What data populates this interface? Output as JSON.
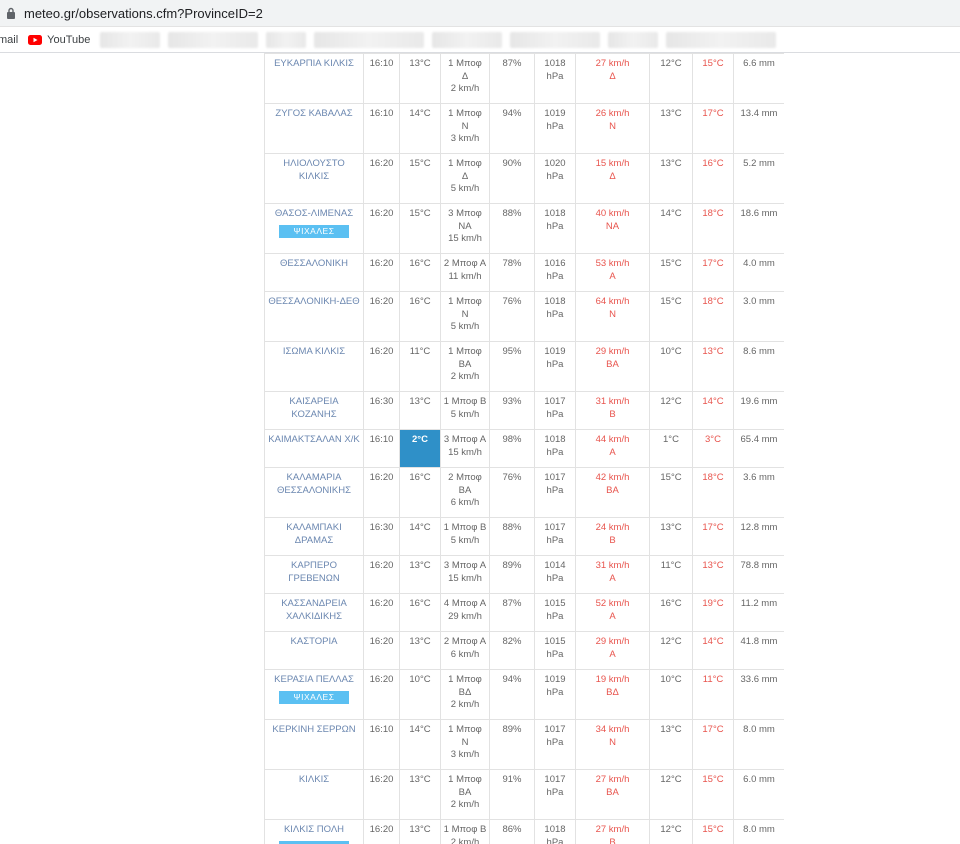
{
  "browser": {
    "url": "meteo.gr/observations.cfm?ProvinceID=2",
    "bookmarks": [
      {
        "label": "mail"
      },
      {
        "label": "YouTube"
      }
    ]
  },
  "colors": {
    "station_name": "#6b87b0",
    "wind_and_max": "#e8544d",
    "badge": "#5bc0f2",
    "highlight": "#2f90c8"
  },
  "rows": [
    {
      "station": "ΕΥΚΑΡΠΙΑ ΚΙΛΚΙΣ",
      "badge": "",
      "time": "16:10",
      "temp": "13°C",
      "hl": false,
      "wind_bf": "1 Μποφ",
      "wind_dir": "Δ",
      "wind_kmh": "2 km/h",
      "humidity": "87%",
      "pressure": "1018",
      "pressure_unit": "hPa",
      "gust": "27 km/h",
      "gust_dir": "Δ",
      "min": "12°C",
      "max": "15°C",
      "rain": "6.6 mm"
    },
    {
      "station": "ΖΥΓΟΣ ΚΑΒΑΛΑΣ",
      "badge": "",
      "time": "16:10",
      "temp": "14°C",
      "hl": false,
      "wind_bf": "1 Μποφ",
      "wind_dir": "Ν",
      "wind_kmh": "3 km/h",
      "humidity": "94%",
      "pressure": "1019",
      "pressure_unit": "hPa",
      "gust": "26 km/h",
      "gust_dir": "Ν",
      "min": "13°C",
      "max": "17°C",
      "rain": "13.4 mm"
    },
    {
      "station": "ΗΛΙΟΛΟΥΣΤΟ ΚΙΛΚΙΣ",
      "badge": "",
      "time": "16:20",
      "temp": "15°C",
      "hl": false,
      "wind_bf": "1 Μποφ",
      "wind_dir": "Δ",
      "wind_kmh": "5 km/h",
      "humidity": "90%",
      "pressure": "1020",
      "pressure_unit": "hPa",
      "gust": "15 km/h",
      "gust_dir": "Δ",
      "min": "13°C",
      "max": "16°C",
      "rain": "5.2 mm"
    },
    {
      "station": "ΘΑΣΟΣ-ΛΙΜΕΝΑΣ",
      "badge": "ΨΙΧΑΛΕΣ",
      "time": "16:20",
      "temp": "15°C",
      "hl": false,
      "wind_bf": "3 Μποφ",
      "wind_dir": "ΝΑ",
      "wind_kmh": "15 km/h",
      "humidity": "88%",
      "pressure": "1018",
      "pressure_unit": "hPa",
      "gust": "40 km/h",
      "gust_dir": "ΝΑ",
      "min": "14°C",
      "max": "18°C",
      "rain": "18.6 mm"
    },
    {
      "station": "ΘΕΣΣΑΛΟΝΙΚΗ",
      "badge": "",
      "time": "16:20",
      "temp": "16°C",
      "hl": false,
      "wind_bf": "2 Μποφ Α",
      "wind_dir": "",
      "wind_kmh": "11 km/h",
      "humidity": "78%",
      "pressure": "1016",
      "pressure_unit": "hPa",
      "gust": "53 km/h",
      "gust_dir": "Α",
      "min": "15°C",
      "max": "17°C",
      "rain": "4.0 mm"
    },
    {
      "station": "ΘΕΣΣΑΛΟΝΙΚΗ-ΔΕΘ",
      "badge": "",
      "time": "16:20",
      "temp": "16°C",
      "hl": false,
      "wind_bf": "1 Μποφ",
      "wind_dir": "Ν",
      "wind_kmh": "5 km/h",
      "humidity": "76%",
      "pressure": "1018",
      "pressure_unit": "hPa",
      "gust": "64 km/h",
      "gust_dir": "Ν",
      "min": "15°C",
      "max": "18°C",
      "rain": "3.0 mm"
    },
    {
      "station": "ΙΣΩΜΑ ΚΙΛΚΙΣ",
      "badge": "",
      "time": "16:20",
      "temp": "11°C",
      "hl": false,
      "wind_bf": "1 Μποφ",
      "wind_dir": "ΒΑ",
      "wind_kmh": "2 km/h",
      "humidity": "95%",
      "pressure": "1019",
      "pressure_unit": "hPa",
      "gust": "29 km/h",
      "gust_dir": "ΒΑ",
      "min": "10°C",
      "max": "13°C",
      "rain": "8.6 mm"
    },
    {
      "station": "ΚΑΙΣΑΡΕΙΑ ΚΟΖΑΝΗΣ",
      "badge": "",
      "time": "16:30",
      "temp": "13°C",
      "hl": false,
      "wind_bf": "1 Μποφ Β",
      "wind_dir": "",
      "wind_kmh": "5 km/h",
      "humidity": "93%",
      "pressure": "1017",
      "pressure_unit": "hPa",
      "gust": "31 km/h",
      "gust_dir": "Β",
      "min": "12°C",
      "max": "14°C",
      "rain": "19.6 mm"
    },
    {
      "station": "ΚΑΙΜΑΚΤΣΑΛΑΝ Χ/Κ",
      "badge": "",
      "time": "16:10",
      "temp": "2°C",
      "hl": true,
      "wind_bf": "3 Μποφ Α",
      "wind_dir": "",
      "wind_kmh": "15 km/h",
      "humidity": "98%",
      "pressure": "1018",
      "pressure_unit": "hPa",
      "gust": "44 km/h",
      "gust_dir": "Α",
      "min": "1°C",
      "max": "3°C",
      "rain": "65.4 mm"
    },
    {
      "station": "ΚΑΛΑΜΑΡΙΑ ΘΕΣΣΑΛΟΝΙΚΗΣ",
      "badge": "",
      "time": "16:20",
      "temp": "16°C",
      "hl": false,
      "wind_bf": "2 Μποφ",
      "wind_dir": "ΒΑ",
      "wind_kmh": "6 km/h",
      "humidity": "76%",
      "pressure": "1017",
      "pressure_unit": "hPa",
      "gust": "42 km/h",
      "gust_dir": "ΒΑ",
      "min": "15°C",
      "max": "18°C",
      "rain": "3.6 mm"
    },
    {
      "station": "ΚΑΛΑΜΠΑΚΙ ΔΡΑΜΑΣ",
      "badge": "",
      "time": "16:30",
      "temp": "14°C",
      "hl": false,
      "wind_bf": "1 Μποφ Β",
      "wind_dir": "",
      "wind_kmh": "5 km/h",
      "humidity": "88%",
      "pressure": "1017",
      "pressure_unit": "hPa",
      "gust": "24 km/h",
      "gust_dir": "Β",
      "min": "13°C",
      "max": "17°C",
      "rain": "12.8 mm"
    },
    {
      "station": "ΚΑΡΠΕΡΟ ΓΡΕΒΕΝΩΝ",
      "badge": "",
      "time": "16:20",
      "temp": "13°C",
      "hl": false,
      "wind_bf": "3 Μποφ Α",
      "wind_dir": "",
      "wind_kmh": "15 km/h",
      "humidity": "89%",
      "pressure": "1014",
      "pressure_unit": "hPa",
      "gust": "31 km/h",
      "gust_dir": "Α",
      "min": "11°C",
      "max": "13°C",
      "rain": "78.8 mm"
    },
    {
      "station": "ΚΑΣΣΑΝΔΡΕΙΑ ΧΑΛΚΙΔΙΚΗΣ",
      "badge": "",
      "time": "16:20",
      "temp": "16°C",
      "hl": false,
      "wind_bf": "4 Μποφ Α",
      "wind_dir": "",
      "wind_kmh": "29 km/h",
      "humidity": "87%",
      "pressure": "1015",
      "pressure_unit": "hPa",
      "gust": "52 km/h",
      "gust_dir": "Α",
      "min": "16°C",
      "max": "19°C",
      "rain": "11.2 mm"
    },
    {
      "station": "ΚΑΣΤΟΡΙΑ",
      "badge": "",
      "time": "16:20",
      "temp": "13°C",
      "hl": false,
      "wind_bf": "2 Μποφ Α",
      "wind_dir": "",
      "wind_kmh": "6 km/h",
      "humidity": "82%",
      "pressure": "1015",
      "pressure_unit": "hPa",
      "gust": "29 km/h",
      "gust_dir": "Α",
      "min": "12°C",
      "max": "14°C",
      "rain": "41.8 mm"
    },
    {
      "station": "ΚΕΡΑΣΙΑ ΠΕΛΛΑΣ",
      "badge": "ΨΙΧΑΛΕΣ",
      "time": "16:20",
      "temp": "10°C",
      "hl": false,
      "wind_bf": "1 Μποφ",
      "wind_dir": "ΒΔ",
      "wind_kmh": "2 km/h",
      "humidity": "94%",
      "pressure": "1019",
      "pressure_unit": "hPa",
      "gust": "19 km/h",
      "gust_dir": "ΒΔ",
      "min": "10°C",
      "max": "11°C",
      "rain": "33.6 mm"
    },
    {
      "station": "ΚΕΡΚΙΝΗ ΣΕΡΡΩΝ",
      "badge": "",
      "time": "16:10",
      "temp": "14°C",
      "hl": false,
      "wind_bf": "1 Μποφ",
      "wind_dir": "Ν",
      "wind_kmh": "3 km/h",
      "humidity": "89%",
      "pressure": "1017",
      "pressure_unit": "hPa",
      "gust": "34 km/h",
      "gust_dir": "Ν",
      "min": "13°C",
      "max": "17°C",
      "rain": "8.0 mm"
    },
    {
      "station": "ΚΙΛΚΙΣ",
      "badge": "",
      "time": "16:20",
      "temp": "13°C",
      "hl": false,
      "wind_bf": "1 Μποφ",
      "wind_dir": "ΒΑ",
      "wind_kmh": "2 km/h",
      "humidity": "91%",
      "pressure": "1017",
      "pressure_unit": "hPa",
      "gust": "27 km/h",
      "gust_dir": "ΒΑ",
      "min": "12°C",
      "max": "15°C",
      "rain": "6.0 mm"
    },
    {
      "station": "ΚΙΛΚΙΣ ΠΟΛΗ",
      "badge": "ΨΙΧΑΛΕΣ",
      "time": "16:20",
      "temp": "13°C",
      "hl": false,
      "wind_bf": "1 Μποφ Β",
      "wind_dir": "",
      "wind_kmh": "2 km/h",
      "humidity": "86%",
      "pressure": "1018",
      "pressure_unit": "hPa",
      "gust": "27 km/h",
      "gust_dir": "Β",
      "min": "12°C",
      "max": "15°C",
      "rain": "8.0 mm"
    }
  ]
}
